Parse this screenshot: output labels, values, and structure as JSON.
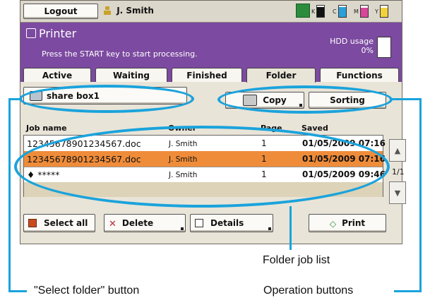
{
  "topbar": {
    "logout_label": "Logout",
    "user_name": "J. Smith",
    "toner": [
      {
        "label": "K",
        "color": "#111111",
        "level": 0.9
      },
      {
        "label": "C",
        "color": "#2ba0d8",
        "level": 0.85
      },
      {
        "label": "M",
        "color": "#d8479a",
        "level": 0.8
      },
      {
        "label": "Y",
        "color": "#f2d23c",
        "level": 0.8
      }
    ]
  },
  "header": {
    "title": "Printer",
    "message": "Press the START key to start processing.",
    "hdd_label": "HDD usage",
    "hdd_value": "0%"
  },
  "tabs": [
    {
      "label": "Active"
    },
    {
      "label": "Waiting"
    },
    {
      "label": "Finished"
    },
    {
      "label": "Folder"
    },
    {
      "label": "Functions"
    }
  ],
  "toolbar": {
    "folder_label": "share box1",
    "copy_label": "Copy",
    "sorting_label": "Sorting"
  },
  "list": {
    "columns": {
      "name": "Job name",
      "owner": "Owner",
      "pages": "Page",
      "saved": "Saved"
    },
    "rows": [
      {
        "name": "12345678901234567.doc",
        "owner": "J. Smith",
        "pages": "1",
        "saved": "01/05/2009 07:16"
      },
      {
        "name": "12345678901234567.doc",
        "owner": "J. Smith",
        "pages": "1",
        "saved": "01/05/2009 07:16"
      },
      {
        "name": "*****",
        "owner": "J. Smith",
        "pages": "1",
        "saved": "01/05/2009 09:46"
      }
    ],
    "page_indicator": "1/1"
  },
  "bottom": {
    "select_all": "Select all",
    "delete": "Delete",
    "details": "Details",
    "print": "Print"
  },
  "callouts": {
    "folder_job_list": "Folder job list",
    "select_folder": "\"Select folder\" button",
    "operation_buttons": "Operation buttons"
  },
  "colors": {
    "header": "#7c4aa0",
    "selected_row": "#ef8c3a",
    "callout": "#1aa3dc"
  }
}
